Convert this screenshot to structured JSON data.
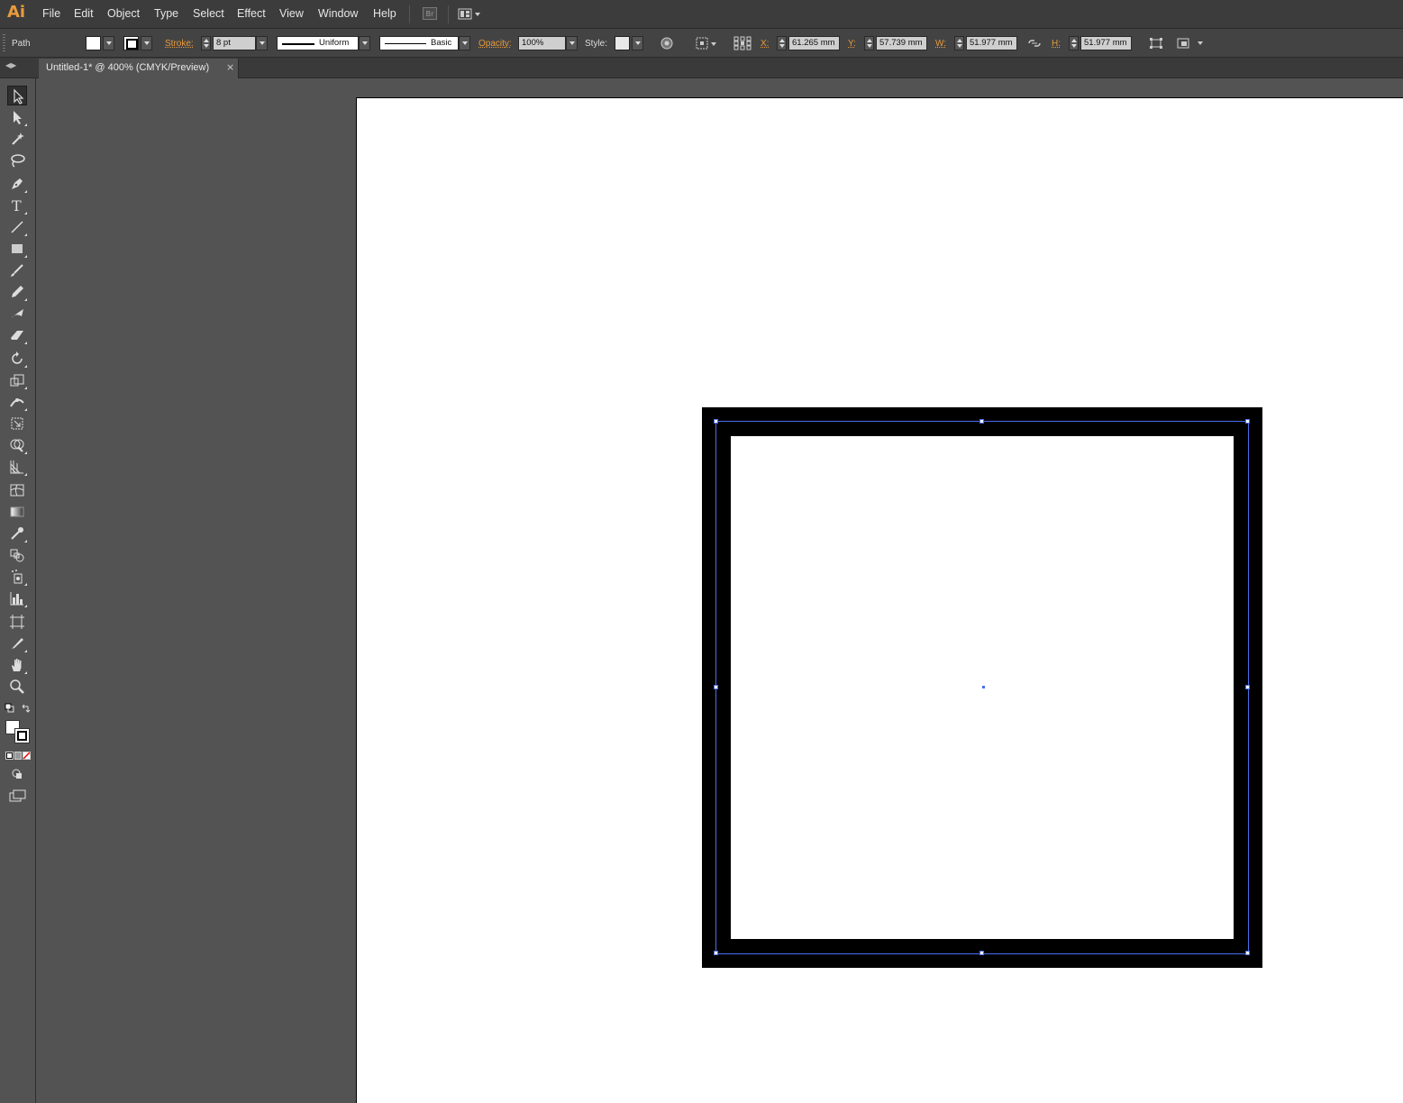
{
  "app": {
    "logo": "Ai"
  },
  "menubar": {
    "items": [
      "File",
      "Edit",
      "Object",
      "Type",
      "Select",
      "Effect",
      "View",
      "Window",
      "Help"
    ],
    "bridge_label": "Br"
  },
  "controlbar": {
    "selection_type": "Path",
    "stroke_label": "Stroke:",
    "stroke_weight": "8 pt",
    "profile": "Uniform",
    "brush": "Basic",
    "opacity_label": "Opacity:",
    "opacity": "100%",
    "style_label": "Style:",
    "x_label": "X:",
    "x_value": "61.265 mm",
    "y_label": "Y:",
    "y_value": "57.739 mm",
    "w_label": "W:",
    "w_value": "51.977 mm",
    "h_label": "H:",
    "h_value": "51.977 mm"
  },
  "document": {
    "tab_title": "Untitled-1* @ 400% (CMYK/Preview)",
    "close_glyph": "×"
  },
  "colors": {
    "accent_orange": "#e89b3c",
    "selection_blue": "#4a6ef0",
    "ui_dark": "#3c3c3c",
    "ui_panel": "#535353"
  },
  "tools": [
    "selection-tool-icon",
    "direct-selection-tool-icon",
    "magic-wand-tool-icon",
    "lasso-tool-icon",
    "pen-tool-icon",
    "type-tool-icon",
    "line-segment-tool-icon",
    "rectangle-tool-icon",
    "paintbrush-tool-icon",
    "pencil-tool-icon",
    "blob-brush-tool-icon",
    "eraser-tool-icon",
    "rotate-tool-icon",
    "scale-tool-icon",
    "width-tool-icon",
    "free-transform-tool-icon",
    "shape-builder-tool-icon",
    "perspective-grid-tool-icon",
    "mesh-tool-icon",
    "gradient-tool-icon",
    "eyedropper-tool-icon",
    "blend-tool-icon",
    "symbol-sprayer-tool-icon",
    "column-graph-tool-icon",
    "artboard-tool-icon",
    "slice-tool-icon",
    "hand-tool-icon",
    "zoom-tool-icon"
  ]
}
